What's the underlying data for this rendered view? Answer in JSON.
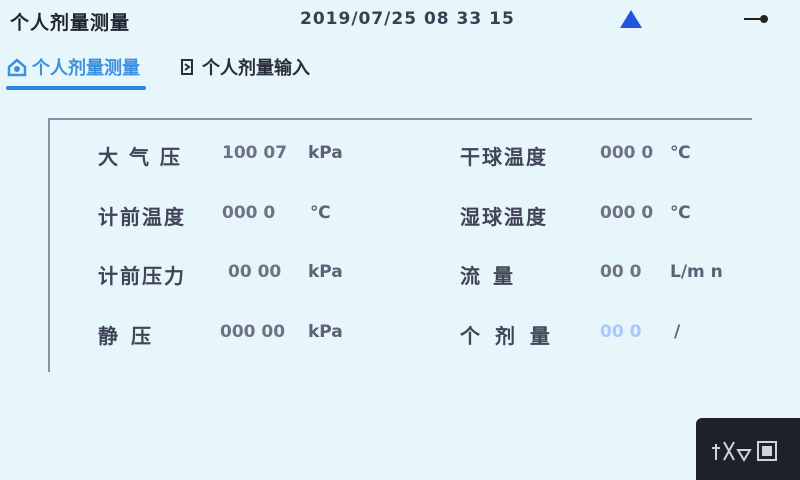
{
  "header": {
    "title": "个人剂量测量",
    "datetime": "2019/07/25 08 33 15",
    "warning_icon": "warning-triangle-icon",
    "key_icon": "key-icon",
    "accent_color": "#2255dd"
  },
  "tabs": [
    {
      "label": "个人剂量测量",
      "icon": "home-icon",
      "active": true
    },
    {
      "label": "个人剂量输入",
      "icon": "input-icon",
      "active": false
    }
  ],
  "left_params": [
    {
      "label": "大 气 压",
      "value": "100 07",
      "unit": "kPa"
    },
    {
      "label": "计前温度",
      "value": "000 0",
      "unit": "℃"
    },
    {
      "label": "计前压力",
      "value": "00 00",
      "unit": "kPa"
    },
    {
      "label": "静    压",
      "value": "000 00",
      "unit": "kPa"
    }
  ],
  "right_params": [
    {
      "label": "干球温度",
      "value": "000 0",
      "unit": "℃"
    },
    {
      "label": "湿球温度",
      "value": "000 0",
      "unit": "℃"
    },
    {
      "label": "流    量",
      "value": "00 0",
      "unit": "L/m n"
    },
    {
      "label": "个 剂 量",
      "value": "00 0",
      "unit": "/"
    }
  ],
  "footer": {
    "corner_icon": "exit-icon"
  }
}
